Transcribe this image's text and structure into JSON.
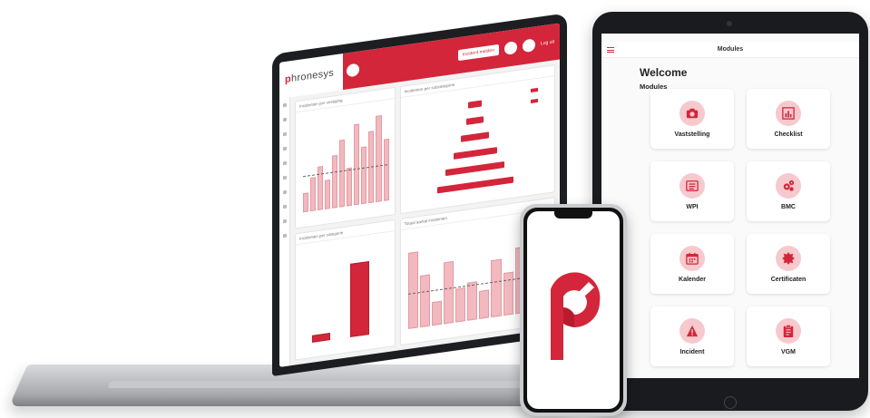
{
  "colors": {
    "brand_red": "#d3263a",
    "tile_icon_bg": "#f6c9cd",
    "device_dark": "#1a1b1e"
  },
  "laptop": {
    "logo_text": "hronesys",
    "incident_button": "Incident melden",
    "logout_label": "Log uit",
    "cards": [
      {
        "title": "Incidenten per vestiging"
      },
      {
        "title": "Incidenten per subcategorie"
      },
      {
        "title": "Incidenten per categorie"
      },
      {
        "title": "Totaal aantal incidenten"
      }
    ],
    "icons": [
      "bell-icon",
      "user-icon"
    ]
  },
  "tablet": {
    "header_title": "Modules",
    "welcome": "Welcome",
    "modules_label": "Modules",
    "modules": [
      {
        "label": "Vaststelling",
        "icon": "camera-icon"
      },
      {
        "label": "Checklist",
        "icon": "bar-chart-icon"
      },
      {
        "label": "WPI",
        "icon": "list-icon"
      },
      {
        "label": "BMC",
        "icon": "gears-icon"
      },
      {
        "label": "Kalender",
        "icon": "calendar-icon"
      },
      {
        "label": "Certificaten",
        "icon": "badge-icon"
      },
      {
        "label": "Incident",
        "icon": "warning-icon"
      },
      {
        "label": "VGM",
        "icon": "clipboard-icon"
      }
    ]
  },
  "phone": {
    "logo_icon": "phronesys-p-logo-icon"
  }
}
